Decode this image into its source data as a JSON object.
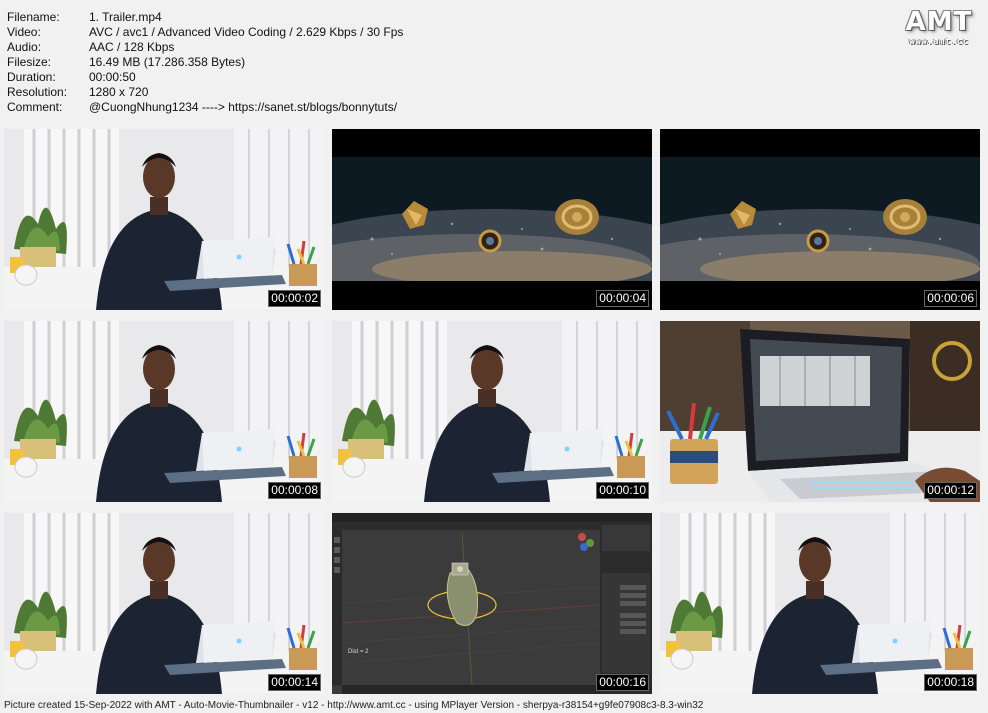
{
  "meta": {
    "rows": [
      {
        "key": "Filename:",
        "value": "1. Trailer.mp4"
      },
      {
        "key": "Video:",
        "value": "AVC / avc1 / Advanced Video Coding / 2.629 Kbps / 30 Fps"
      },
      {
        "key": "Audio:",
        "value": "AAC / 128 Kbps"
      },
      {
        "key": "Filesize:",
        "value": "16.49 MB (17.286.358 Bytes)"
      },
      {
        "key": "Duration:",
        "value": "00:00:50"
      },
      {
        "key": "Resolution:",
        "value": "1280 x 720"
      },
      {
        "key": "Comment:",
        "value": "@CuongNhung1234 ----> https://sanet.st/blogs/bonnytuts/"
      }
    ]
  },
  "logo": {
    "title": "AMT",
    "url": "www.amt.cc"
  },
  "thumbnails": [
    {
      "time": "00:00:02",
      "scene": "presenter"
    },
    {
      "time": "00:00:04",
      "scene": "jewelry-closeup"
    },
    {
      "time": "00:00:06",
      "scene": "jewelry-closeup"
    },
    {
      "time": "00:00:08",
      "scene": "presenter"
    },
    {
      "time": "00:00:10",
      "scene": "presenter"
    },
    {
      "time": "00:00:12",
      "scene": "laptop-closeup"
    },
    {
      "time": "00:00:14",
      "scene": "presenter"
    },
    {
      "time": "00:00:16",
      "scene": "blender-viewport"
    },
    {
      "time": "00:00:18",
      "scene": "presenter"
    }
  ],
  "blender": {
    "overlay_text": "Dist = 2"
  },
  "footer": {
    "text": "Picture created 15-Sep-2022 with AMT - Auto-Movie-Thumbnailer - v12 - http://www.amt.cc - using MPlayer Version - sherpya-r38154+g9fe07908c3-8.3-win32"
  },
  "colors": {
    "page_bg": "#f1f1f1",
    "wall": "#e9e9ec",
    "desk": "#f4f4f4",
    "jacket": "#1c2333",
    "viewport_bg": "#3b3b3b",
    "timestamp_bg": "#000000"
  }
}
